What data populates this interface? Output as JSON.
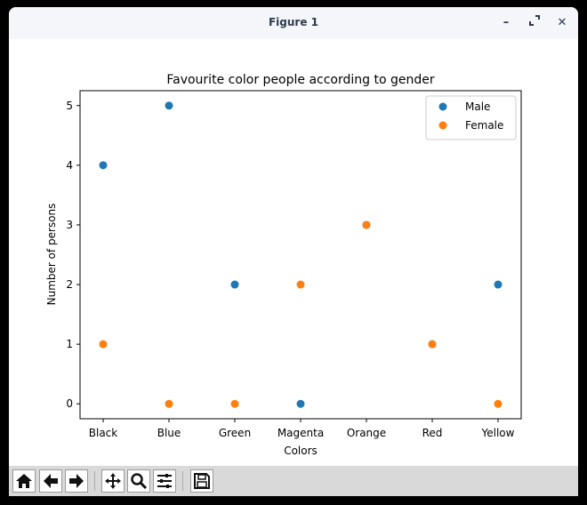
{
  "window": {
    "title": "Figure 1",
    "minimize_label": "–",
    "maximize_label": "⤢",
    "close_label": "✕"
  },
  "toolbar": {
    "buttons": [
      "home-icon",
      "back-icon",
      "forward-icon",
      "pan-icon",
      "zoom-icon",
      "configure-subplots-icon",
      "save-icon"
    ]
  },
  "chart_data": {
    "type": "scatter",
    "title": "Favourite color people according to gender",
    "xlabel": "Colors",
    "ylabel": "Number of persons",
    "categories": [
      "Black",
      "Blue",
      "Green",
      "Magenta",
      "Orange",
      "Red",
      "Yellow"
    ],
    "yticks": [
      0,
      1,
      2,
      3,
      4,
      5
    ],
    "ylim": [
      -0.25,
      5.25
    ],
    "grid": false,
    "legend_position": "top-right",
    "series": [
      {
        "name": "Male",
        "color": "#1f77b4",
        "values": [
          4,
          5,
          2,
          0,
          3,
          1,
          2
        ]
      },
      {
        "name": "Female",
        "color": "#ff7f0e",
        "values": [
          1,
          0,
          0,
          2,
          3,
          1,
          0
        ]
      }
    ]
  }
}
